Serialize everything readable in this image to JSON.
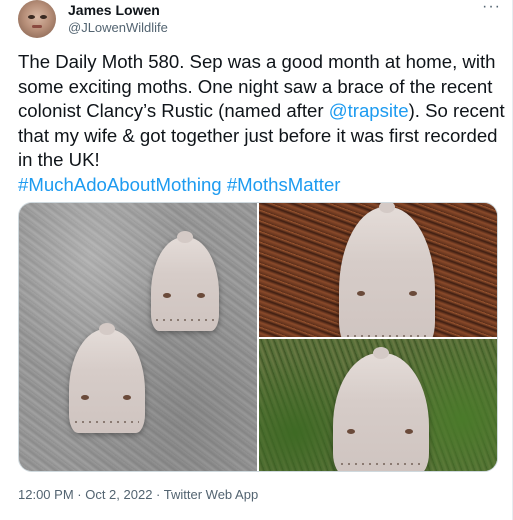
{
  "author": {
    "display_name": "James Lowen",
    "handle": "@JLowenWildlife",
    "avatar_icon": "profile-photo"
  },
  "menu": {
    "more_label": "···",
    "icon": "more-horizontal-icon"
  },
  "tweet": {
    "text_part1": "The Daily Moth 580. Sep was a good month at home, with some exciting moths. One night saw a brace of the recent colonist Clancy’s Rustic (named after ",
    "mention": "@trapsite",
    "text_part2": "). So recent that my wife & got together just before it was first recorded in the UK!\n",
    "hashtag1": "#MuchAdoAboutMothing",
    "hashtag2": "#MothsMatter"
  },
  "media": {
    "photos": [
      {
        "name": "photo-two-moths-on-stone"
      },
      {
        "name": "photo-moth-on-bark-chips"
      },
      {
        "name": "photo-moth-on-moss"
      }
    ]
  },
  "footer": {
    "time": "12:00 PM",
    "date": "Oct 2, 2022",
    "source": "Twitter Web App",
    "separator": " · "
  },
  "colors": {
    "link": "#1d9bf0",
    "secondary_text": "#536471",
    "primary_text": "#0f1419"
  }
}
